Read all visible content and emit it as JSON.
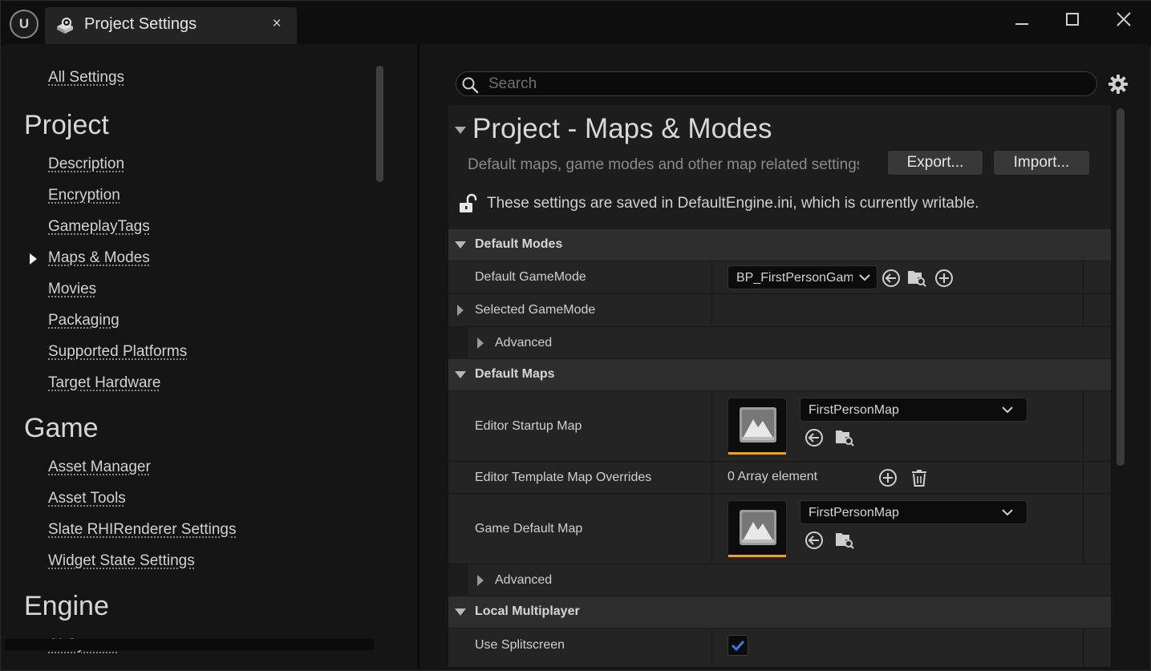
{
  "window": {
    "tab_title": "Project Settings",
    "tab_close": "×",
    "logo_text": "U",
    "controls": {
      "minimize": "minimize",
      "maximize": "maximize",
      "close": "close"
    }
  },
  "nav": {
    "all_settings": "All Settings",
    "categories": [
      {
        "title": "Project",
        "items": [
          "Description",
          "Encryption",
          "GameplayTags",
          "Maps & Modes",
          "Movies",
          "Packaging",
          "Supported Platforms",
          "Target Hardware"
        ]
      },
      {
        "title": "Game",
        "items": [
          "Asset Manager",
          "Asset Tools",
          "Slate RHIRenderer Settings",
          "Widget State Settings"
        ]
      },
      {
        "title": "Engine",
        "items": [
          "AI System"
        ]
      }
    ],
    "selected": "Maps & Modes"
  },
  "search": {
    "placeholder": "Search",
    "value": ""
  },
  "section": {
    "title": "Project - Maps & Modes",
    "description": "Default maps, game modes and other map related settings.",
    "export_label": "Export...",
    "import_label": "Import...",
    "ini_note": "These settings are saved in DefaultEngine.ini, which is currently writable."
  },
  "categories": {
    "default_modes": {
      "label": "Default Modes",
      "default_gamemode": {
        "label": "Default GameMode",
        "value": "BP_FirstPersonGameMode"
      },
      "selected_gamemode": {
        "label": "Selected GameMode"
      },
      "advanced": {
        "label": "Advanced"
      }
    },
    "default_maps": {
      "label": "Default Maps",
      "editor_startup_map": {
        "label": "Editor Startup Map",
        "value": "FirstPersonMap"
      },
      "editor_template_overrides": {
        "label": "Editor Template Map Overrides",
        "value": "0 Array element"
      },
      "game_default_map": {
        "label": "Game Default Map",
        "value": "FirstPersonMap"
      },
      "advanced": {
        "label": "Advanced"
      }
    },
    "local_multiplayer": {
      "label": "Local Multiplayer",
      "use_splitscreen": {
        "label": "Use Splitscreen",
        "checked": true
      }
    }
  },
  "colors": {
    "accent": "#f0a01e",
    "check": "#2f7fe8",
    "background": "#151515"
  }
}
